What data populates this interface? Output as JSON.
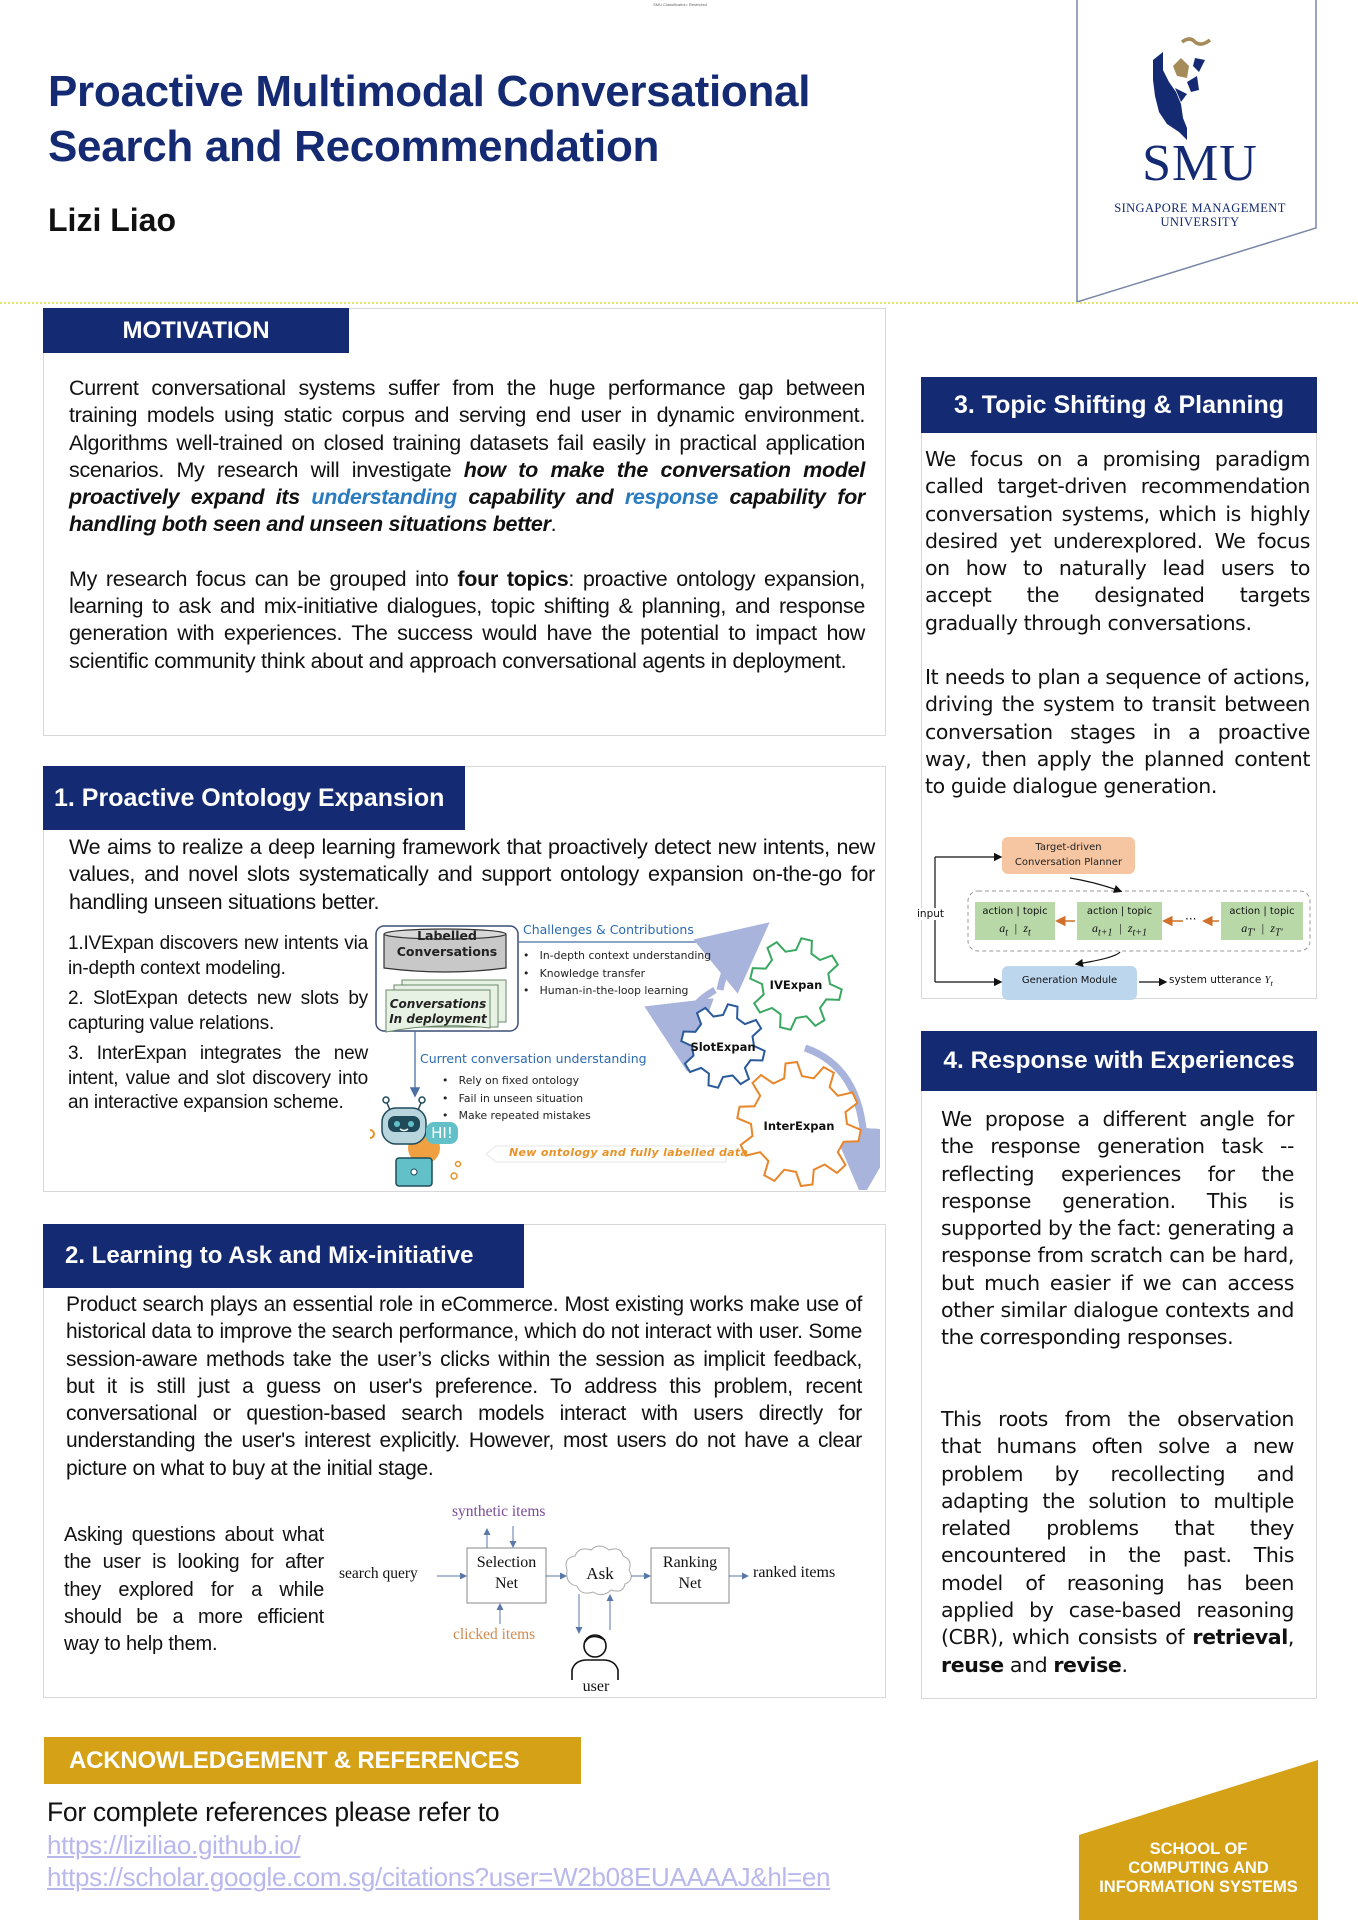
{
  "classification": "SMU Classification: Restricted",
  "header": {
    "title_line1": "Proactive Multimodal Conversational",
    "title_line2": "Search and Recommendation",
    "author": "Lizi Liao"
  },
  "logo": {
    "abbr": "SMU",
    "name_line1": "SINGAPORE MANAGEMENT",
    "name_line2": "UNIVERSITY"
  },
  "colors": {
    "navy": "#142a72",
    "gold": "#d4a117",
    "accent_blue": "#2a7bbf"
  },
  "motivation": {
    "heading": "MOTIVATION",
    "p1_plain": "Current conversational systems suffer from the huge performance gap between training models using static corpus and serving end user in dynamic environment. Algorithms well-trained on closed training datasets fail easily in practical application scenarios. My research will investigate ",
    "p1_bold1": "how to make the conversation model proactively expand its ",
    "p1_blue1": "understanding",
    "p1_bold2": " capability and ",
    "p1_blue2": "response",
    "p1_bold3": " capability for handling both seen and unseen situations better",
    "p1_end": ".",
    "p2_pre": "My research focus can be grouped into ",
    "p2_bold": "four topics",
    "p2_post": ": proactive ontology expansion, learning to ask and mix-initiative dialogues, topic shifting & planning, and response generation with experiences. The success would have the potential to impact how scientific community think about and approach conversational agents in deployment."
  },
  "section1": {
    "heading": "1. Proactive Ontology Expansion",
    "intro": "We aims to realize a deep learning framework that proactively detect new intents, new values, and novel slots systematically and support ontology expansion on-the-go for handling unseen situations better.",
    "points": [
      "1.IVExpan discovers new intents via in-depth context modeling.",
      "2. SlotExpan detects new slots by capturing value relations.",
      "3. InterExpan integrates the new intent, value and slot discovery into an interactive expansion scheme."
    ],
    "diagram": {
      "db_line1": "Labelled",
      "db_line2": "Conversations",
      "doc_line1": "Conversations",
      "doc_line2": "In deployment",
      "challenges_title": "Challenges & Contributions",
      "challenges": [
        "In-depth context understanding",
        "Knowledge transfer",
        "Human-in-the-loop learning"
      ],
      "current_title": "Current conversation understanding",
      "current": [
        "Rely on fixed ontology",
        "Fail in unseen situation",
        "Make repeated mistakes"
      ],
      "bubble": "HI!",
      "feedback": "New ontology and fully labelled data",
      "gears": [
        "IVExpan",
        "SlotExpan",
        "InterExpan"
      ]
    }
  },
  "section2": {
    "heading": "2. Learning to Ask and Mix-initiative",
    "paragraph": "Product search plays an essential role in eCommerce. Most existing works make use of historical data to improve the search performance, which do not interact with user. Some session-aware methods take the user’s clicks within the session as implicit feedback, but it is still just a guess on user's preference. To address this problem, recent conversational or question-based search models interact with users directly for understanding the user's interest explicitly. However, most users do not have a clear picture on what to buy at the initial stage.",
    "side_text": "Asking questions about what the user is looking for after they explored for a while should be a more efficient way to help them.",
    "diagram": {
      "input": "search query",
      "synthetic": "synthetic items",
      "clicked": "clicked items",
      "selection_line1": "Selection",
      "selection_line2": "Net",
      "ask": "Ask",
      "ranking_line1": "Ranking",
      "ranking_line2": "Net",
      "output": "ranked items",
      "user": "user"
    }
  },
  "section3": {
    "heading": "3. Topic Shifting & Planning",
    "p1": "We focus on a promising paradigm called target-driven recommendation conversation systems, which is highly desired yet underexplored. We focus on how to naturally lead users to accept the designated targets gradually through conversations.",
    "p2": "It needs to plan a sequence of actions, driving the system to transit between conversation stages in a proactive way, then apply the planned content to guide dialogue generation.",
    "diagram": {
      "planner_line1": "Target-driven",
      "planner_line2": "Conversation Planner",
      "input": "input",
      "cell_label": "action | topic",
      "cells": [
        {
          "a": "a",
          "a_sub": "t",
          "z": "z",
          "z_sub": "t"
        },
        {
          "a": "a",
          "a_sub": "t+1",
          "z": "z",
          "z_sub": "t+1"
        },
        {
          "a": "a",
          "a_sub": "T'",
          "z": "z",
          "z_sub": "T'"
        }
      ],
      "ellipsis": "···",
      "generation": "Generation Module",
      "output": "system utterance",
      "output_sym": "Y",
      "output_sub": "t"
    }
  },
  "section4": {
    "heading": "4. Response with Experiences",
    "p1": "We propose a different angle for the response generation task -- reflecting experiences for the response generation. This is supported by the fact: generating a response from scratch can be hard, but much easier if we can access other similar dialogue contexts and the corresponding responses.",
    "p2_plain": "This roots from the observation that humans often solve a new problem by recollecting and adapting the solution to multiple related problems that they encountered in the past. This model of reasoning has been applied by case-based reasoning (CBR), which consists of ",
    "p2_b1": "retrieval",
    "p2_mid1": ", ",
    "p2_b2": "reuse",
    "p2_mid2": " and ",
    "p2_b3": "revise",
    "p2_end": "."
  },
  "references": {
    "heading": "ACKNOWLEDGEMENT & REFERENCES",
    "intro": "For complete references please refer to",
    "links": [
      "https://liziliao.github.io/",
      "https://scholar.google.com.sg/citations?user=W2b08EUAAAAJ&hl=en"
    ]
  },
  "school": {
    "line1": "SCHOOL OF",
    "line2": "COMPUTING AND",
    "line3": "INFORMATION SYSTEMS"
  }
}
